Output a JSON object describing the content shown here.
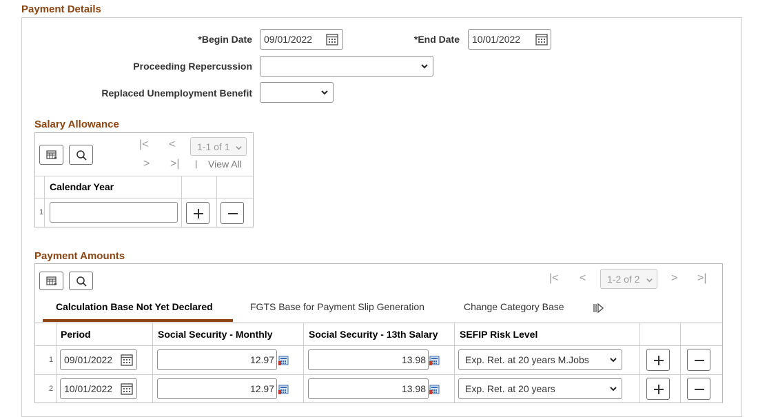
{
  "section_title": "Payment Details",
  "begin_date": {
    "label": "*Begin Date",
    "value": "09/01/2022"
  },
  "end_date": {
    "label": "*End Date",
    "value": "10/01/2022"
  },
  "proceeding_repercussion": {
    "label": "Proceeding Repercussion",
    "value": ""
  },
  "replaced_unemployment_benefit": {
    "label": "Replaced Unemployment Benefit",
    "value": ""
  },
  "salary_allowance": {
    "title": "Salary Allowance",
    "pager": "1-1 of 1",
    "view_all": "View All",
    "separator": "|",
    "column_header": "Calendar Year",
    "rows": [
      {
        "num": "1",
        "calendar_year": ""
      }
    ]
  },
  "payment_amounts": {
    "title": "Payment Amounts",
    "pager": "1-2 of 2",
    "tabs": [
      "Calculation Base Not Yet Declared",
      "FGTS Base for Payment Slip Generation",
      "Change Category Base"
    ],
    "active_tab": 0,
    "columns": [
      "Period",
      "Social Security - Monthly",
      "Social Security - 13th Salary",
      "SEFIP Risk Level"
    ],
    "rows": [
      {
        "num": "1",
        "period": "09/01/2022",
        "ss_monthly": "12.97",
        "ss_13th": "13.98",
        "sefip": "Exp. Ret. at 20 years M.Jobs"
      },
      {
        "num": "2",
        "period": "10/01/2022",
        "ss_monthly": "12.97",
        "ss_13th": "13.98",
        "sefip": "Exp. Ret. at 20 years"
      }
    ]
  },
  "icons": {
    "calendar": "calendar-icon",
    "chevron": "chevron-down-icon",
    "grid": "grid-personalize-icon",
    "search": "search-icon",
    "add": "plus-icon",
    "remove": "minus-icon",
    "first": "first-page-icon",
    "prev": "prev-page-icon",
    "next": "next-page-icon",
    "last": "last-page-icon",
    "show_all_tabs": "show-all-tabs-icon",
    "calculator": "calculator-icon"
  },
  "colors": {
    "title": "#8b4512",
    "active_tab_underline": "#8b4512",
    "border": "#cfcfcf"
  }
}
